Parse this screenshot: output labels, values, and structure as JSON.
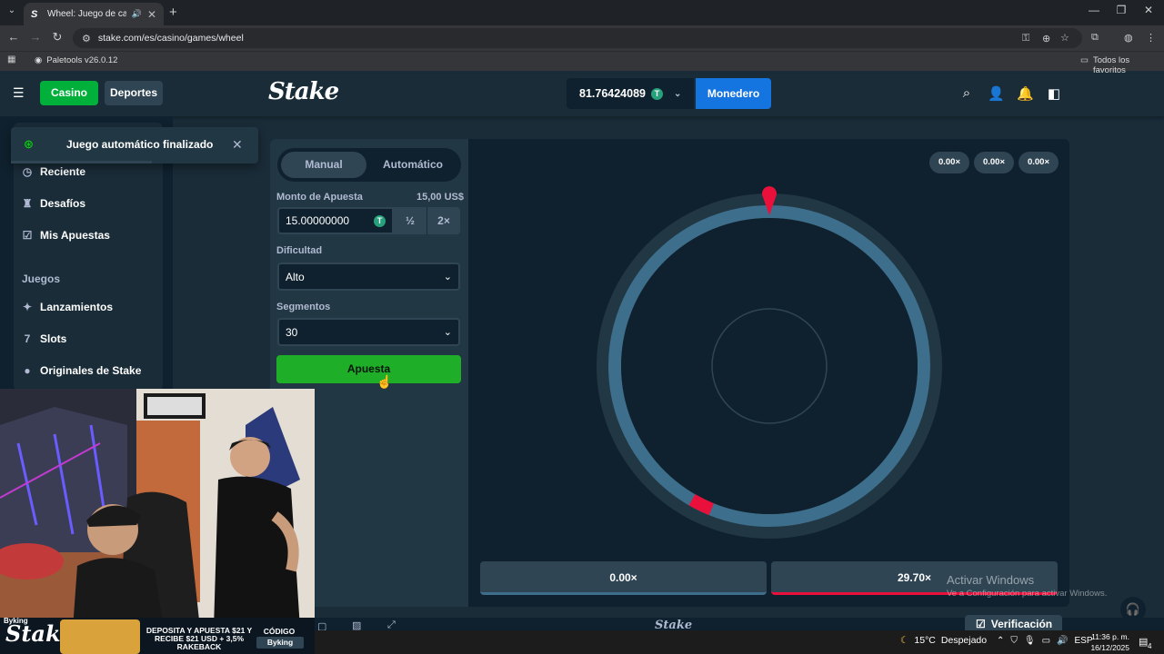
{
  "browser": {
    "tab_title": "Wheel: Juego de casino onl",
    "tab_close": "✕",
    "new_tab": "+",
    "url": "stake.com/es/casino/games/wheel",
    "bookmark_item": "Paletools v26.0.12",
    "bookmark_all": "Todos los favoritos",
    "window_controls": [
      "—",
      "❐",
      "✕"
    ]
  },
  "header": {
    "casino_label": "Casino",
    "sports_label": "Deportes",
    "logo": "Stake",
    "balance": "81.76424089",
    "currency_icon": "T",
    "wallet_label": "Monedero"
  },
  "toast": {
    "message": "Juego automático finalizado",
    "close": "✕"
  },
  "sidebar": {
    "items": [
      {
        "label": "Reciente",
        "icon": "clock-icon"
      },
      {
        "label": "Desafíos",
        "icon": "trophy-icon"
      },
      {
        "label": "Mis Apuestas",
        "icon": "bets-icon"
      }
    ],
    "section": "Juegos",
    "games": [
      {
        "label": "Lanzamientos",
        "icon": "sparkle-icon"
      },
      {
        "label": "Slots",
        "icon": "slots-icon"
      },
      {
        "label": "Originales de Stake",
        "icon": "originals-icon"
      }
    ]
  },
  "controls": {
    "tab_manual": "Manual",
    "tab_auto": "Automático",
    "bet_label": "Monto de Apuesta",
    "bet_usd": "15,00 US$",
    "bet_value": "15.00000000",
    "half": "½",
    "double": "2×",
    "difficulty_label": "Dificultad",
    "difficulty_value": "Alto",
    "segments_label": "Segmentos",
    "segments_value": "30",
    "bet_button": "Apuesta"
  },
  "history": [
    "0.00×",
    "0.00×",
    "0.00×"
  ],
  "results": {
    "left": "0.00×",
    "right": "29.70×"
  },
  "overlay": {
    "activate_title": "Activar Windows",
    "activate_sub": "Ve a Configuración para activar Windows."
  },
  "footer": {
    "logo": "Stake",
    "verification": "Verificación"
  },
  "stream_banner": {
    "streamer": "Byking",
    "logo": "Stake",
    "promo": "DEPOSITA Y APUESTA $21 Y RECIBE $21 USD + 3,5% RAKEBACK",
    "code_label": "CÓDIGO",
    "code_value": "Byking"
  },
  "taskbar": {
    "temperature": "15°C",
    "weather": "Despejado",
    "language": "ESP",
    "time": "11:36 p. m.",
    "date": "16/12/2025",
    "notifications": "4"
  },
  "colors": {
    "accent_green": "#00b03b",
    "wallet_blue": "#1475e1",
    "wheel_segment": "#3d6e8b",
    "win_segment": "#e9113c"
  }
}
